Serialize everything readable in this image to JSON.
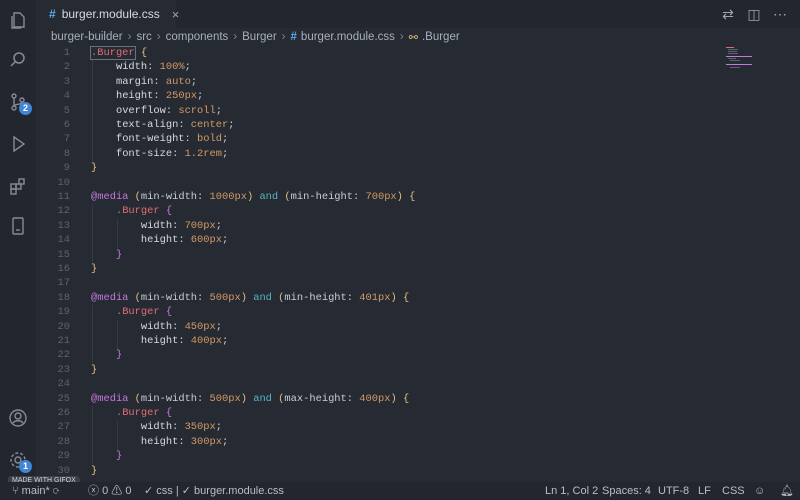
{
  "tab": {
    "icon": "#",
    "label": "burger.module.css"
  },
  "breadcrumb": [
    "burger-builder",
    "src",
    "components",
    "Burger",
    "burger.module.css",
    ".Burger"
  ],
  "activity": {
    "scm_badge": "2",
    "settings_badge": "1"
  },
  "code_lines": [
    {
      "n": "1",
      "html": "<span class='sel'><span class='hl'>.Burger</span></span> <span class='brk'>{</span>"
    },
    {
      "n": "2",
      "html": "    <span class='prop'>width</span>: <span class='num'>100%</span>;"
    },
    {
      "n": "3",
      "html": "    <span class='prop'>margin</span>: <span class='val'>auto</span>;"
    },
    {
      "n": "4",
      "html": "    <span class='prop'>height</span>: <span class='num'>250px</span>;"
    },
    {
      "n": "5",
      "html": "    <span class='prop'>overflow</span>: <span class='val'>scroll</span>;"
    },
    {
      "n": "6",
      "html": "    <span class='prop'>text-align</span>: <span class='val'>center</span>;"
    },
    {
      "n": "7",
      "html": "    <span class='prop'>font-weight</span>: <span class='val'>bold</span>;"
    },
    {
      "n": "8",
      "html": "    <span class='prop'>font-size</span>: <span class='num'>1.2rem</span>;"
    },
    {
      "n": "9",
      "html": "<span class='brk'>}</span>"
    },
    {
      "n": "10",
      "html": ""
    },
    {
      "n": "11",
      "html": "<span class='at'>@media</span> <span class='brk'>(</span>min-width: <span class='num'>1000px</span><span class='brk'>)</span> <span class='kw'>and</span> <span class='brk'>(</span>min-height: <span class='num'>700px</span><span class='brk'>)</span> <span class='brk'>{</span>"
    },
    {
      "n": "12",
      "html": "    <span class='sel'>.Burger</span> <span class='brk2'>{</span>"
    },
    {
      "n": "13",
      "html": "        <span class='prop'>width</span>: <span class='num'>700px</span>;"
    },
    {
      "n": "14",
      "html": "        <span class='prop'>height</span>: <span class='num'>600px</span>;"
    },
    {
      "n": "15",
      "html": "    <span class='brk2'>}</span>"
    },
    {
      "n": "16",
      "html": "<span class='brk'>}</span>"
    },
    {
      "n": "17",
      "html": ""
    },
    {
      "n": "18",
      "html": "<span class='at'>@media</span> <span class='brk'>(</span>min-width: <span class='num'>500px</span><span class='brk'>)</span> <span class='kw'>and</span> <span class='brk'>(</span>min-height: <span class='num'>401px</span><span class='brk'>)</span> <span class='brk'>{</span>"
    },
    {
      "n": "19",
      "html": "    <span class='sel'>.Burger</span> <span class='brk2'>{</span>"
    },
    {
      "n": "20",
      "html": "        <span class='prop'>width</span>: <span class='num'>450px</span>;"
    },
    {
      "n": "21",
      "html": "        <span class='prop'>height</span>: <span class='num'>400px</span>;"
    },
    {
      "n": "22",
      "html": "    <span class='brk2'>}</span>"
    },
    {
      "n": "23",
      "html": "<span class='brk'>}</span>"
    },
    {
      "n": "24",
      "html": ""
    },
    {
      "n": "25",
      "html": "<span class='at'>@media</span> <span class='brk'>(</span>min-width: <span class='num'>500px</span><span class='brk'>)</span> <span class='kw'>and</span> <span class='brk'>(</span>max-height: <span class='num'>400px</span><span class='brk'>)</span> <span class='brk'>{</span>"
    },
    {
      "n": "26",
      "html": "    <span class='sel'>.Burger</span> <span class='brk2'>{</span>"
    },
    {
      "n": "27",
      "html": "        <span class='prop'>width</span>: <span class='num'>350px</span>;"
    },
    {
      "n": "28",
      "html": "        <span class='prop'>height</span>: <span class='num'>300px</span>;"
    },
    {
      "n": "29",
      "html": "    <span class='brk2'>}</span>"
    },
    {
      "n": "30",
      "html": "<span class='brk'>}</span>"
    }
  ],
  "status": {
    "branch": "main*",
    "errors": "0",
    "warnings": "0",
    "lang_check": "css",
    "file_check": "burger.module.css",
    "position": "Ln 1, Col 2",
    "spaces": "Spaces: 4",
    "encoding": "UTF-8",
    "eol": "LF",
    "language": "CSS"
  },
  "watermark": "MADE WITH GIFOX"
}
